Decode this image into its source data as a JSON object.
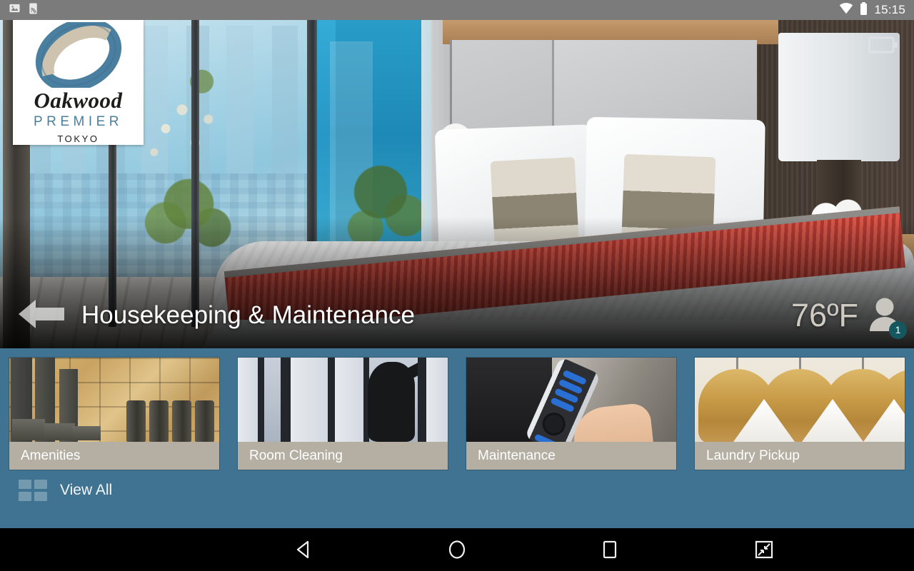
{
  "statusbar": {
    "icons_left": [
      "image-icon",
      "screencast-icon"
    ],
    "icons_right": [
      "wifi-icon",
      "battery-icon"
    ],
    "clock": "15:15"
  },
  "logo": {
    "mark": "oakwood-o-monogram",
    "word": "Oakwood",
    "tier": "PREMIER",
    "city": "TOKYO"
  },
  "hero": {
    "battery_indicator": "battery-icon",
    "back_label": "back-arrow",
    "title": "Housekeeping & Maintenance",
    "temperature": "76ºF",
    "user_icon": "person-icon",
    "user_badge": "1"
  },
  "cards": [
    {
      "label": "Amenities",
      "image": "hotel-amenities-toiletries"
    },
    {
      "label": "Room Cleaning",
      "image": "housekeeper-at-window"
    },
    {
      "label": "Maintenance",
      "image": "hand-holding-tv-remote"
    },
    {
      "label": "Laundry Pickup",
      "image": "wooden-hangers-with-towels"
    }
  ],
  "view_all": {
    "icon": "grid-icon",
    "label": "View All"
  },
  "navbar": {
    "back": "back-triangle-icon",
    "home": "home-circle-icon",
    "recents": "recents-square-icon",
    "shrink": "shrink-screen-icon"
  },
  "colors": {
    "content_bg": "#3f7391",
    "card_label_bg": "#b5afa3",
    "status_bar": "#7b7b7b",
    "badge": "#14575f",
    "brand_blue": "#4a7fa0"
  }
}
